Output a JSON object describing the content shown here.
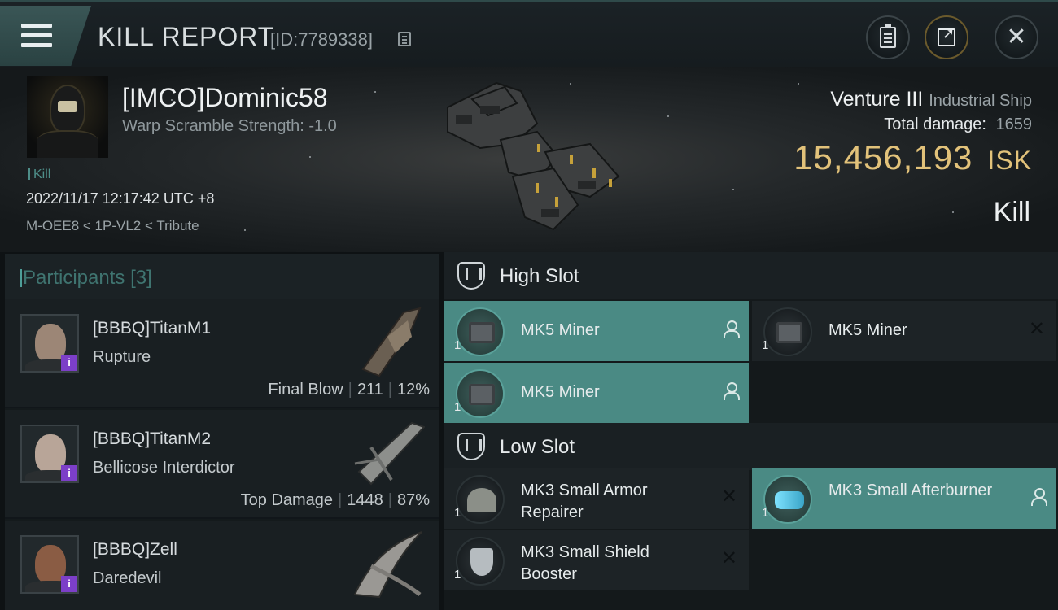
{
  "header": {
    "title": "KILL REPORT",
    "report_id": "[ID:7789338]",
    "buttons": [
      "clipboard-icon",
      "share-icon",
      "close-icon"
    ]
  },
  "victim": {
    "name": "[IMCO]Dominic58",
    "warp_scramble": "Warp Scramble Strength: -1.0",
    "tag": "Kill",
    "timestamp": "2022/11/17 12:17:42 UTC +8",
    "location": "M-OEE8 < 1P-VL2 < Tribute",
    "ship": "Venture III",
    "ship_class": "Industrial Ship",
    "total_damage_label": "Total damage:",
    "total_damage": "1659",
    "isk_value": "15,456,193",
    "isk_unit": "ISK",
    "result": "Kill"
  },
  "participants": {
    "title": "Participants",
    "count": "[3]",
    "rows": [
      {
        "name": "[BBBQ]TitanM1",
        "ship": "Rupture",
        "role": "Final Blow",
        "damage": "211",
        "percent": "12%",
        "badge": "i"
      },
      {
        "name": "[BBBQ]TitanM2",
        "ship": "Bellicose Interdictor",
        "role": "Top Damage",
        "damage": "1448",
        "percent": "87%",
        "badge": "i"
      },
      {
        "name": "[BBBQ]Zell",
        "ship": "Daredevil",
        "badge": "i"
      }
    ]
  },
  "fitting": {
    "high_slot_title": "High Slot",
    "low_slot_title": "Low Slot",
    "high_modules": [
      {
        "name": "MK5 Miner",
        "qty": "1",
        "state": "dropped"
      },
      {
        "name": "MK5 Miner",
        "qty": "1",
        "state": "destroyed"
      },
      {
        "name": "MK5 Miner",
        "qty": "1",
        "state": "dropped"
      }
    ],
    "low_modules": [
      {
        "name": "MK3 Small Armor Repairer",
        "qty": "1",
        "state": "destroyed"
      },
      {
        "name": "MK3 Small Afterburner",
        "qty": "1",
        "state": "dropped"
      },
      {
        "name": "MK3 Small Shield Booster",
        "qty": "1",
        "state": "destroyed"
      }
    ]
  },
  "colors": {
    "accent_teal": "#4a8a84",
    "isk_gold": "#e2c27a",
    "badge_purple": "#7c3fc8"
  }
}
